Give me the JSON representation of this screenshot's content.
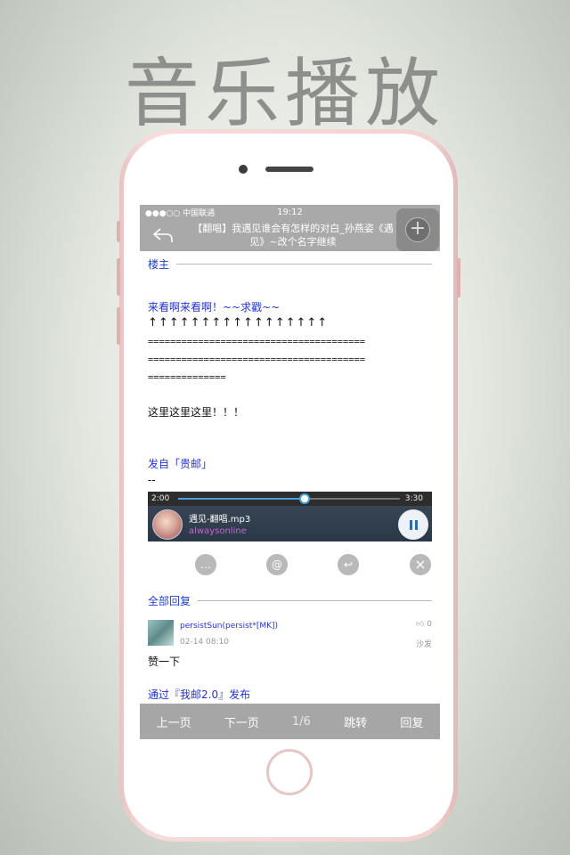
{
  "headline": "音乐播放",
  "status_bar": {
    "carrier": "●●●○○ 中国联通 ",
    "time": "19:12"
  },
  "nav": {
    "title": "【翻唱】我遇见谁会有怎样的对白_孙燕姿《遇见》~改个名字继续",
    "back_icon": "back-arrow-icon",
    "add_icon": "plus-icon"
  },
  "post": {
    "section_label": "楼主",
    "line1": "来看啊来看啊！~~求戳~~",
    "arrows": "↑↑↑↑↑↑↑↑↑↑↑↑↑↑↑↑↑",
    "equals1": "=======================================",
    "equals2": "=======================================",
    "equals3": "==============",
    "line2": "这里这里这里！！！",
    "source": "发自「贵邮」",
    "sig": "--"
  },
  "player": {
    "elapsed": "2:00",
    "total": "3:30",
    "progress": 0.57,
    "song": "遇见-翻唱.mp3",
    "artist": "alwaysonline"
  },
  "actions": {
    "comment": "…",
    "mention": "@",
    "reply": "↩",
    "close": "×"
  },
  "replies": {
    "section_label": "全部回复",
    "user": "persistSun(persist*[MK])",
    "date": "02-14 08:10",
    "like_count": "0",
    "floor": "沙发",
    "text": "赞一下",
    "via": "通过『我邮2.0』发布"
  },
  "toolbar": {
    "prev": "上一页",
    "next": "下一页",
    "page": "1/6",
    "jump": "跳转",
    "reply": "回复"
  }
}
